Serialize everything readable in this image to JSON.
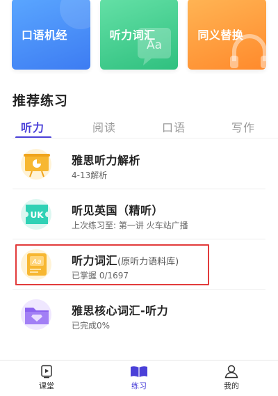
{
  "top_cards": [
    {
      "label": "口语机经",
      "color": "#4a8ef8"
    },
    {
      "label": "听力词汇",
      "color": "#3fcf8e"
    },
    {
      "label": "同义替换",
      "color": "#ff9e3d"
    }
  ],
  "section_title": "推荐练习",
  "tabs": [
    {
      "label": "听力",
      "active": true
    },
    {
      "label": "阅读",
      "active": false
    },
    {
      "label": "口语",
      "active": false
    },
    {
      "label": "写作",
      "active": false
    }
  ],
  "list": [
    {
      "title": "雅思听力解析",
      "note": "",
      "subtitle": "4-13解析",
      "icon": "presentation-chart-icon",
      "icon_color": "#f7b731"
    },
    {
      "title": "听见英国（精听）",
      "note": "",
      "subtitle": "上次练习至: 第一讲 火车站广播",
      "icon": "uk-ticket-icon",
      "icon_color": "#2fd1b5"
    },
    {
      "title": "听力词汇",
      "note": "(原听力语料库)",
      "subtitle": "已掌握 0/1697",
      "icon": "vocabulary-book-icon",
      "icon_color": "#f7b731"
    },
    {
      "title": "雅思核心词汇-听力",
      "note": "",
      "subtitle": "已完成0%",
      "icon": "folder-diamond-icon",
      "icon_color": "#8c63f0"
    }
  ],
  "bottom_nav": [
    {
      "label": "课堂",
      "icon": "classroom-icon",
      "active": false
    },
    {
      "label": "练习",
      "icon": "book-icon",
      "active": true
    },
    {
      "label": "我的",
      "icon": "profile-icon",
      "active": false
    }
  ],
  "accent_color": "#4a40d8",
  "highlight_color": "#e23b3b"
}
